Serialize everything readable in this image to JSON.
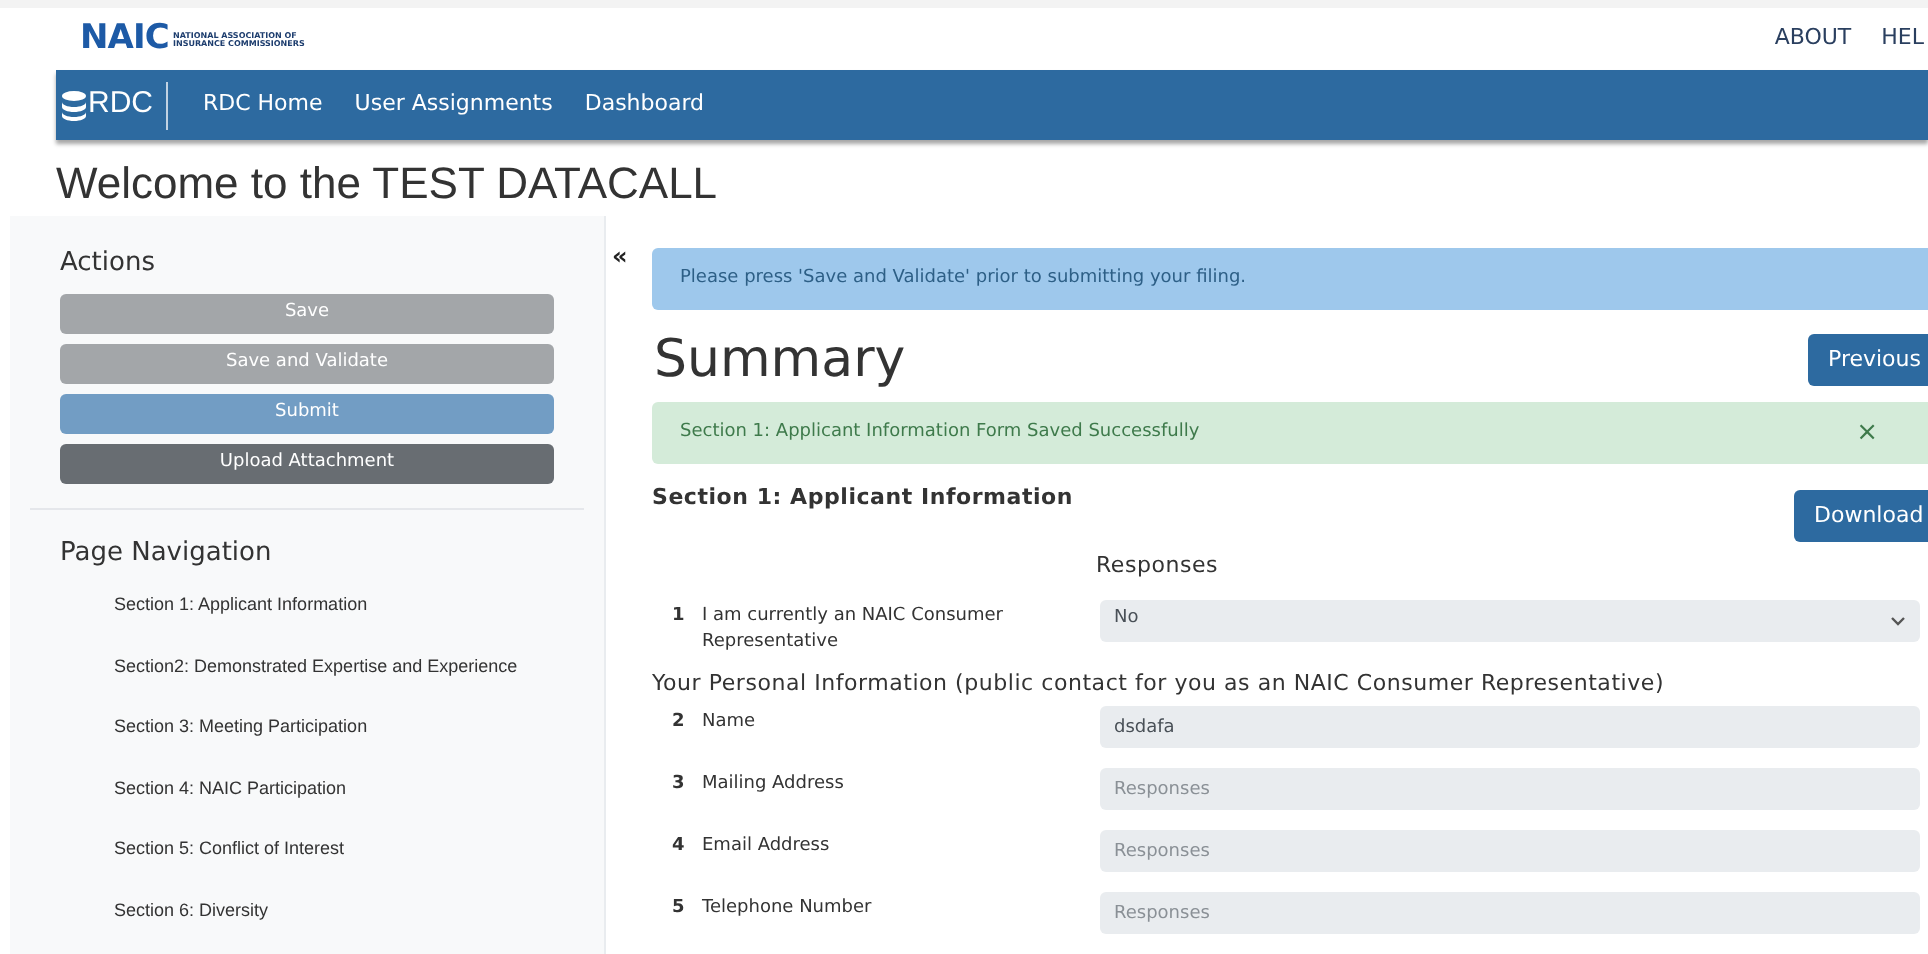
{
  "header": {
    "logo": {
      "mark": "NAIC",
      "line1": "NATIONAL ASSOCIATION OF",
      "line2": "INSURANCE COMMISSIONERS"
    },
    "links": [
      "ABOUT",
      "HEL"
    ]
  },
  "navbar": {
    "brand": "RDC",
    "items": [
      "RDC Home",
      "User Assignments",
      "Dashboard"
    ]
  },
  "page_title": "Welcome to the TEST DATACALL",
  "sidebar": {
    "actions_title": "Actions",
    "actions": [
      {
        "label": "Save",
        "kind": "secondary"
      },
      {
        "label": "Save and Validate",
        "kind": "secondary"
      },
      {
        "label": "Submit",
        "kind": "primary"
      },
      {
        "label": "Upload Attachment",
        "kind": "dark"
      }
    ],
    "nav_title": "Page Navigation",
    "nav_items": [
      "Section 1: Applicant Information",
      "Section2: Demonstrated Expertise and Experience",
      "Section 3: Meeting Participation",
      "Section 4: NAIC Participation",
      "Section 5: Conflict of Interest",
      "Section 6: Diversity"
    ],
    "collapse": "«"
  },
  "main": {
    "info_alert": "Please press 'Save and Validate' prior to submitting your filing.",
    "title": "Summary",
    "previous_button": "Previous",
    "success_alert": {
      "text": "Section 1: Applicant Information Form Saved Successfully",
      "close": "×"
    },
    "section_title": "Section 1: Applicant Information",
    "download_button": "Download",
    "responses_heading": "Responses",
    "questions": [
      {
        "kind": "select",
        "number": "1",
        "label": "I am currently an NAIC Consumer Representative",
        "value": "No"
      },
      {
        "kind": "heading",
        "label": "Your Personal Information (public contact for you as an NAIC Consumer Representative)"
      },
      {
        "kind": "text",
        "number": "2",
        "label": "Name",
        "value": "dsdafa"
      },
      {
        "kind": "text",
        "number": "3",
        "label": "Mailing Address",
        "placeholder": "Responses"
      },
      {
        "kind": "text",
        "number": "4",
        "label": "Email Address",
        "placeholder": "Responses"
      },
      {
        "kind": "text",
        "number": "5",
        "label": "Telephone Number",
        "placeholder": "Responses"
      }
    ]
  }
}
